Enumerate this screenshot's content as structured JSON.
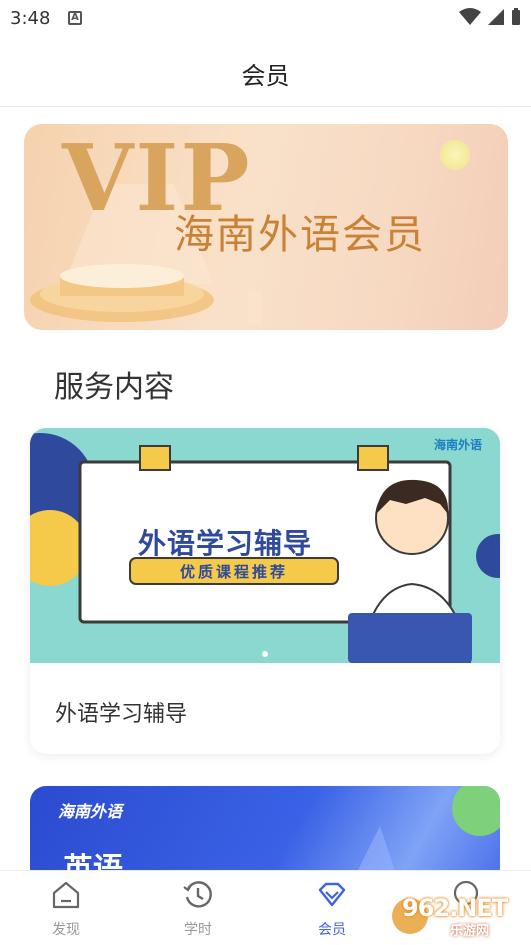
{
  "status": {
    "time": "3:48",
    "indicator": "A"
  },
  "header": {
    "title": "会员"
  },
  "banner": {
    "vip_text": "VIP",
    "subtitle": "海南外语会员"
  },
  "section": {
    "title": "服务内容"
  },
  "service_cards": [
    {
      "image_title": "外语学习辅导",
      "image_tag": "优质课程推荐",
      "brand": "海南外语",
      "label": "外语学习辅导"
    },
    {
      "brand": "海南外语",
      "image_title": "英语"
    }
  ],
  "tabs": [
    {
      "label": "发现",
      "icon": "home-icon",
      "active": false
    },
    {
      "label": "学时",
      "icon": "history-icon",
      "active": false
    },
    {
      "label": "会员",
      "icon": "diamond-icon",
      "active": true
    }
  ],
  "watermark": {
    "text": "962.NET",
    "sub": "乐游网"
  },
  "colors": {
    "accent": "#3f63e6",
    "inactive": "#999999",
    "gold": "#c98235"
  }
}
